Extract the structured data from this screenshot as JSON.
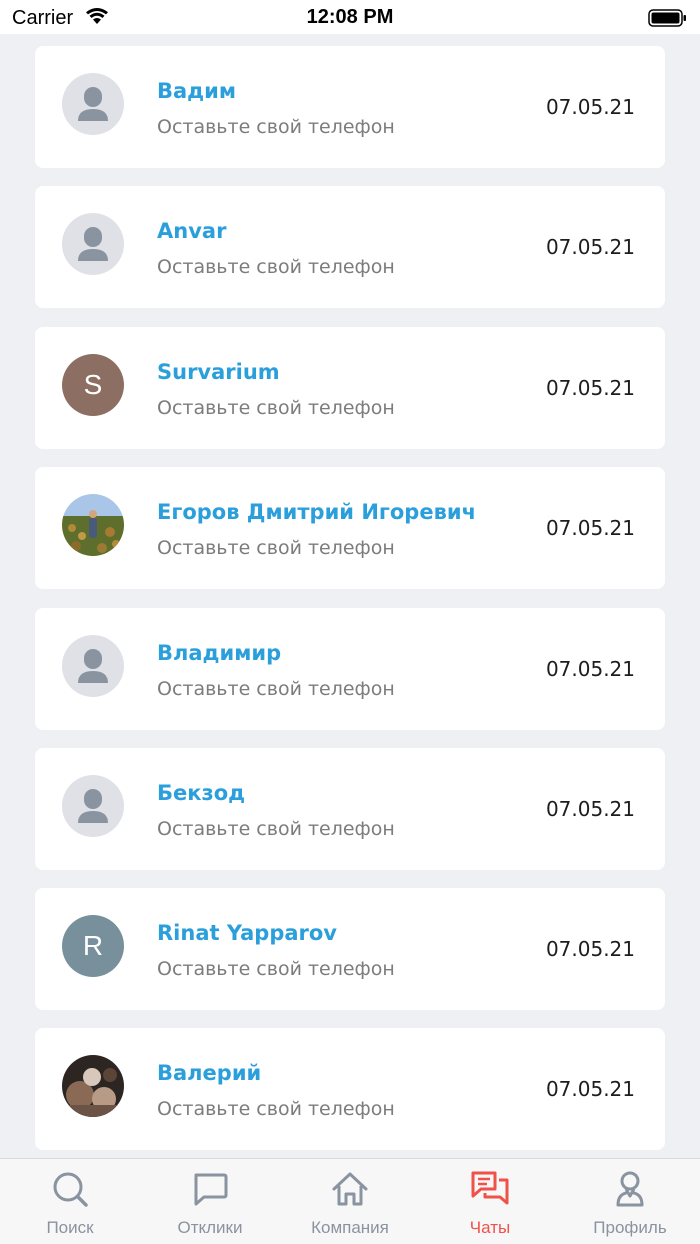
{
  "status_bar": {
    "carrier": "Carrier",
    "time": "12:08 PM"
  },
  "chats": [
    {
      "name": "Вадим",
      "preview": "Оставьте свой телефон",
      "date": "07.05.21",
      "avatar": "placeholder"
    },
    {
      "name": "Anvar",
      "preview": "Оставьте свой телефон",
      "date": "07.05.21",
      "avatar": "placeholder"
    },
    {
      "name": "Survarium",
      "preview": "Оставьте свой телефон",
      "date": "07.05.21",
      "avatar": "initial",
      "initial": "S",
      "avatar_color": "#8d6e63"
    },
    {
      "name": "Егоров Дмитрий Игоревич",
      "preview": "Оставьте свой телефон",
      "date": "07.05.21",
      "avatar": "photo-field"
    },
    {
      "name": "Владимир",
      "preview": "Оставьте свой телефон",
      "date": "07.05.21",
      "avatar": "placeholder"
    },
    {
      "name": "Бекзод",
      "preview": "Оставьте свой телефон",
      "date": "07.05.21",
      "avatar": "placeholder"
    },
    {
      "name": "Rinat Yapparov",
      "preview": "Оставьте свой телефон",
      "date": "07.05.21",
      "avatar": "initial",
      "initial": "R",
      "avatar_color": "#78909c"
    },
    {
      "name": "Валерий",
      "preview": "Оставьте свой телефон",
      "date": "07.05.21",
      "avatar": "photo-dark"
    }
  ],
  "tabs": [
    {
      "label": "Поиск",
      "icon": "search-icon",
      "active": false
    },
    {
      "label": "Отклики",
      "icon": "chat-bubble-icon",
      "active": false
    },
    {
      "label": "Компания",
      "icon": "home-icon",
      "active": false
    },
    {
      "label": "Чаты",
      "icon": "chats-icon",
      "active": true
    },
    {
      "label": "Профиль",
      "icon": "profile-icon",
      "active": false
    }
  ],
  "colors": {
    "name": "#2b9fdc",
    "active_tab": "#f0524a",
    "inactive_tab": "#8a93a0",
    "background": "#eff0f4"
  }
}
